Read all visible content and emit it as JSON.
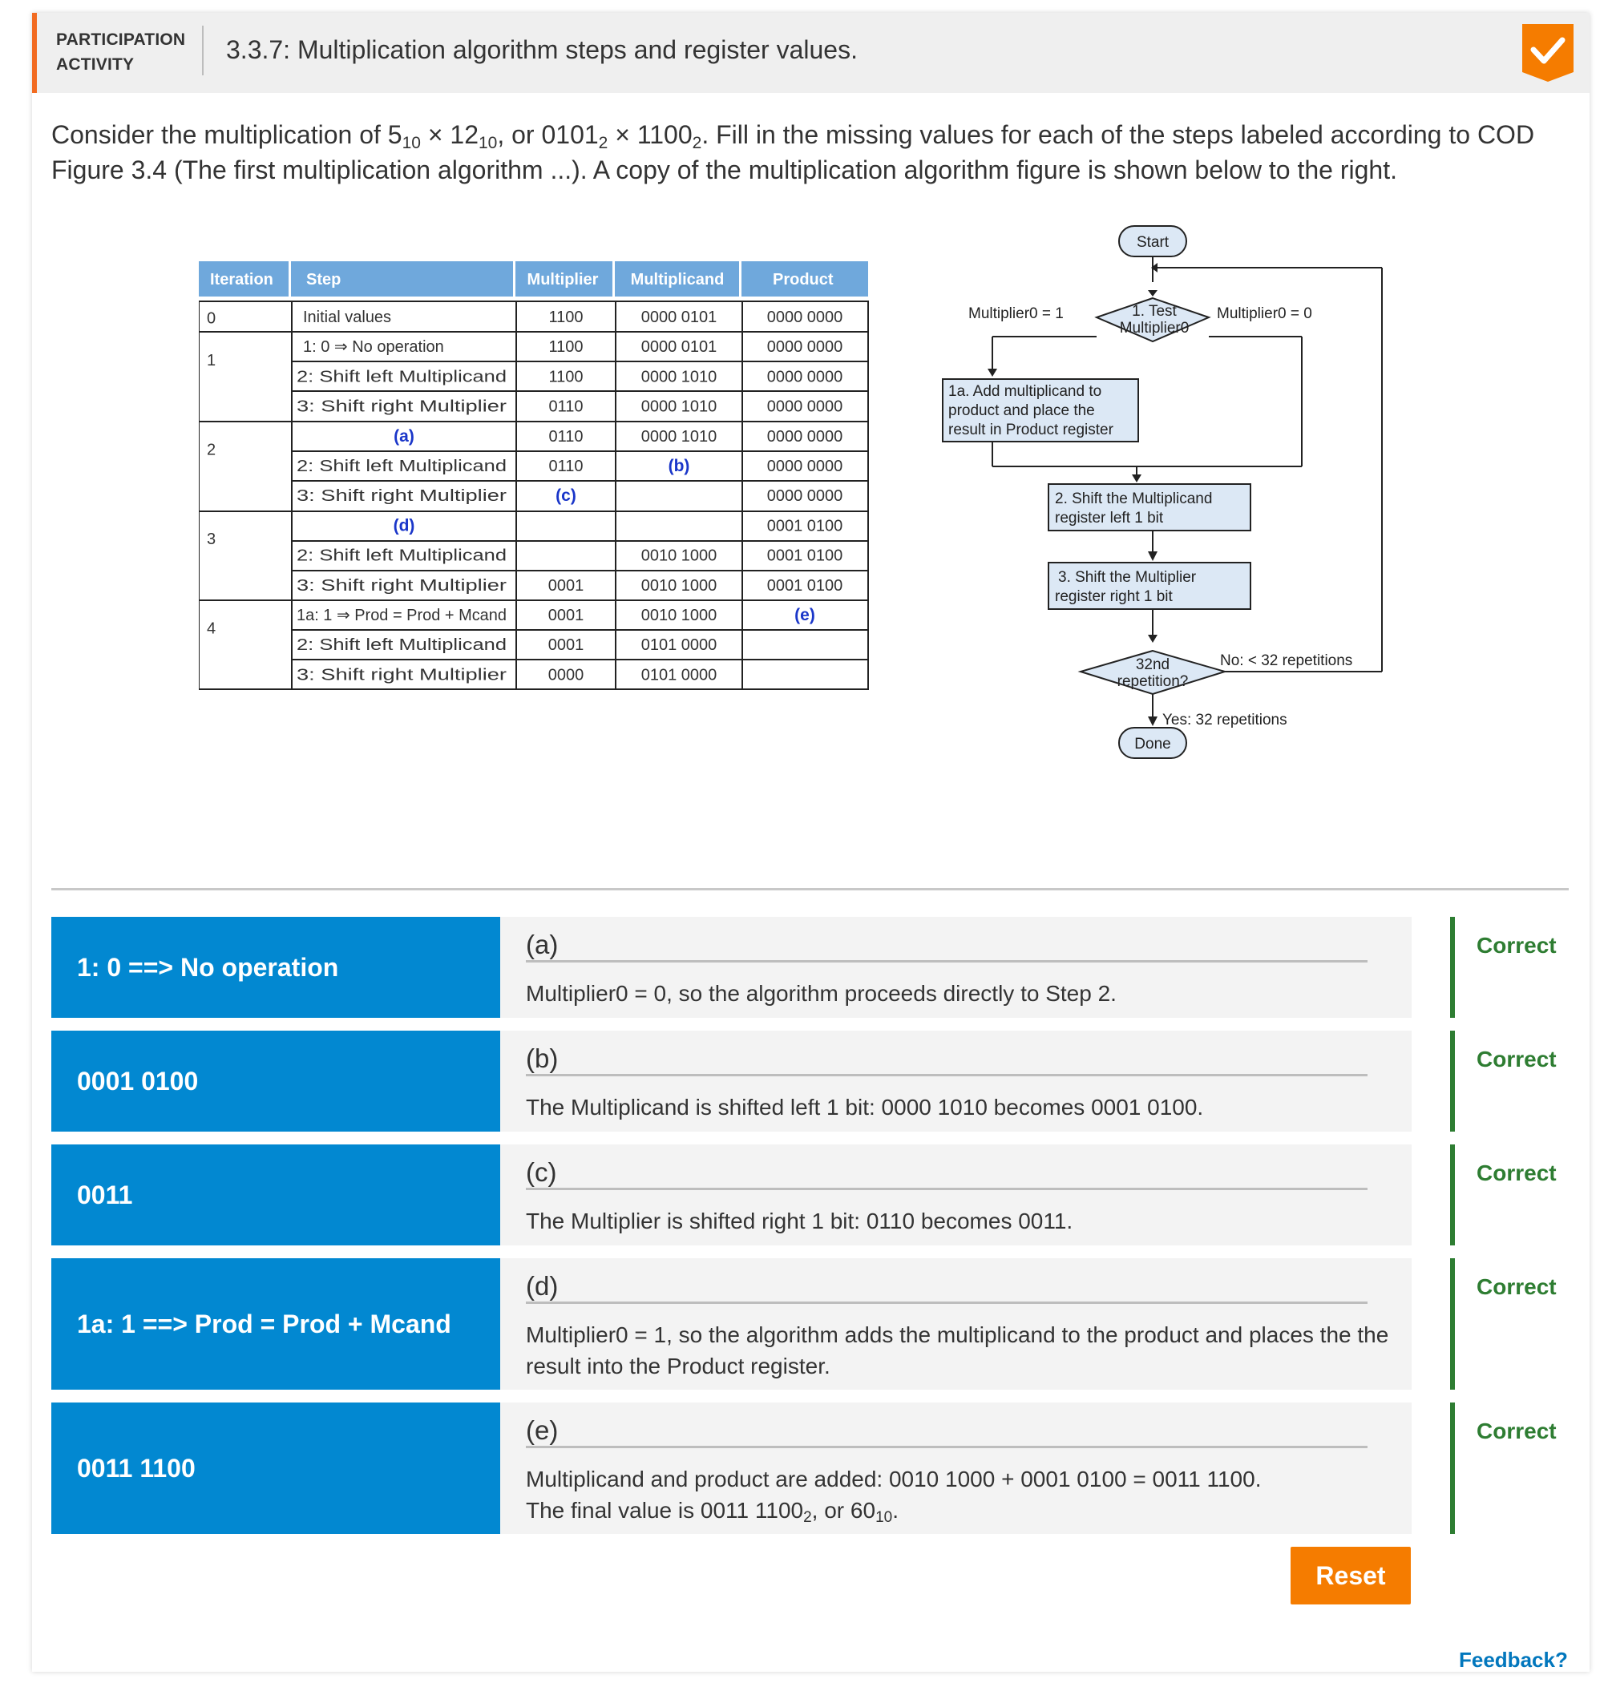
{
  "header": {
    "label_line1": "PARTICIPATION",
    "label_line2": "ACTIVITY",
    "title": "3.3.7: Multiplication algorithm steps and register values."
  },
  "intro": {
    "p1": "Consider the multiplication of 5",
    "s1": "10",
    "p2": " × 12",
    "s2": "10",
    "p3": ", or 0101",
    "s3": "2",
    "p4": " × 1100",
    "s4": "2",
    "p5": ". Fill in the missing values for each of the steps labeled according to COD Figure 3.4 (The first multiplication algorithm ...). A copy of the multiplication algorithm figure is shown below to the right."
  },
  "table": {
    "headers": [
      "Iteration",
      "Step",
      "Multiplier",
      "Multiplicand",
      "Product"
    ],
    "iterations": [
      "0",
      "1",
      "2",
      "3",
      "4"
    ],
    "rows": [
      {
        "step": "Initial values",
        "multiplier": "1100",
        "multiplicand": "0000 0101",
        "product": "0000 0000"
      },
      {
        "step": "1: 0 ⇒ No operation",
        "multiplier": "1100",
        "multiplicand": "0000 0101",
        "product": "0000 0000"
      },
      {
        "step": "2: Shift left Multiplicand",
        "multiplier": "1100",
        "multiplicand": "0000 1010",
        "product": "0000 0000"
      },
      {
        "step": "3: Shift right Multiplier",
        "multiplier": "0110",
        "multiplicand": "0000 1010",
        "product": "0000 0000"
      },
      {
        "step": "(a)",
        "multiplier": "0110",
        "multiplicand": "0000 1010",
        "product": "0000 0000"
      },
      {
        "step": "2: Shift left Multiplicand",
        "multiplier": "0110",
        "multiplicand": "(b)",
        "product": "0000 0000"
      },
      {
        "step": "3: Shift right Multiplier",
        "multiplier": "(c)",
        "multiplicand": "",
        "product": "0000 0000"
      },
      {
        "step": "(d)",
        "multiplier": "",
        "multiplicand": "",
        "product": "0001 0100"
      },
      {
        "step": "2: Shift left Multiplicand",
        "multiplier": "",
        "multiplicand": "0010 1000",
        "product": "0001 0100"
      },
      {
        "step": "3: Shift right Multiplier",
        "multiplier": "0001",
        "multiplicand": "0010 1000",
        "product": "0001 0100"
      },
      {
        "step": "1a: 1 ⇒ Prod = Prod + Mcand",
        "multiplier": "0001",
        "multiplicand": "0010 1000",
        "product": "(e)"
      },
      {
        "step": "2: Shift left Multiplicand",
        "multiplier": "0001",
        "multiplicand": "0101 0000",
        "product": ""
      },
      {
        "step": "3: Shift right Multiplier",
        "multiplier": "0000",
        "multiplicand": "0101 0000",
        "product": ""
      }
    ]
  },
  "flowchart": {
    "start": "Start",
    "test_line1": "1. Test",
    "test_line2": "Multiplier0",
    "left_branch": "Multiplier0 = 1",
    "right_branch": "Multiplier0 = 0",
    "add_line1": "1a. Add multiplicand to",
    "add_line2": "product and place the",
    "add_line3": "result in Product register",
    "shift1_line1": "2. Shift the Multiplicand",
    "shift1_line2": "register left 1 bit",
    "shift2_line1": "3. Shift the Multiplier",
    "shift2_line2": "register right 1 bit",
    "rep_line1": "32nd",
    "rep_line2": "repetition?",
    "no_label": "No: < 32 repetitions",
    "yes_label": "Yes: 32 repetitions",
    "done": "Done"
  },
  "questions": [
    {
      "answer": "1: 0 ==> No operation",
      "label": "(a)",
      "explanation": "Multiplier0 = 0, so the algorithm proceeds directly to Step 2.",
      "status": "Correct"
    },
    {
      "answer": "0001 0100",
      "label": "(b)",
      "explanation": "The Multiplicand is shifted left 1 bit: 0000 1010 becomes 0001 0100.",
      "status": "Correct"
    },
    {
      "answer": "0011",
      "label": "(c)",
      "explanation": "The Multiplier is shifted right 1 bit: 0110 becomes 0011.",
      "status": "Correct"
    },
    {
      "answer": "1a: 1 ==> Prod = Prod + Mcand",
      "label": "(d)",
      "explanation": "Multiplier0 = 1, so the algorithm adds the multiplicand to the product and places the the result into the Product register.",
      "status": "Correct"
    },
    {
      "answer": "0011 1100",
      "label": "(e)",
      "explanation_line1": "Multiplicand and product are added: 0010 1000 + 0001 0100 = 0011 1100.",
      "explanation_line2_a": "The final value is 0011 1100",
      "explanation_line2_s1": "2",
      "explanation_line2_b": ", or 60",
      "explanation_line2_s2": "10",
      "explanation_line2_c": ".",
      "status": "Correct"
    }
  ],
  "buttons": {
    "reset": "Reset",
    "feedback": "Feedback?"
  },
  "icons": {
    "completion": "checkmark-icon"
  },
  "colors": {
    "accent": "#f26b21",
    "answer_bg": "#0288d1",
    "correct": "#2e7d32",
    "reset_bg": "#f57c00",
    "table_header": "#6fa8dc",
    "flow_box": "#dce8f5",
    "blank_label": "#1a36c9"
  }
}
